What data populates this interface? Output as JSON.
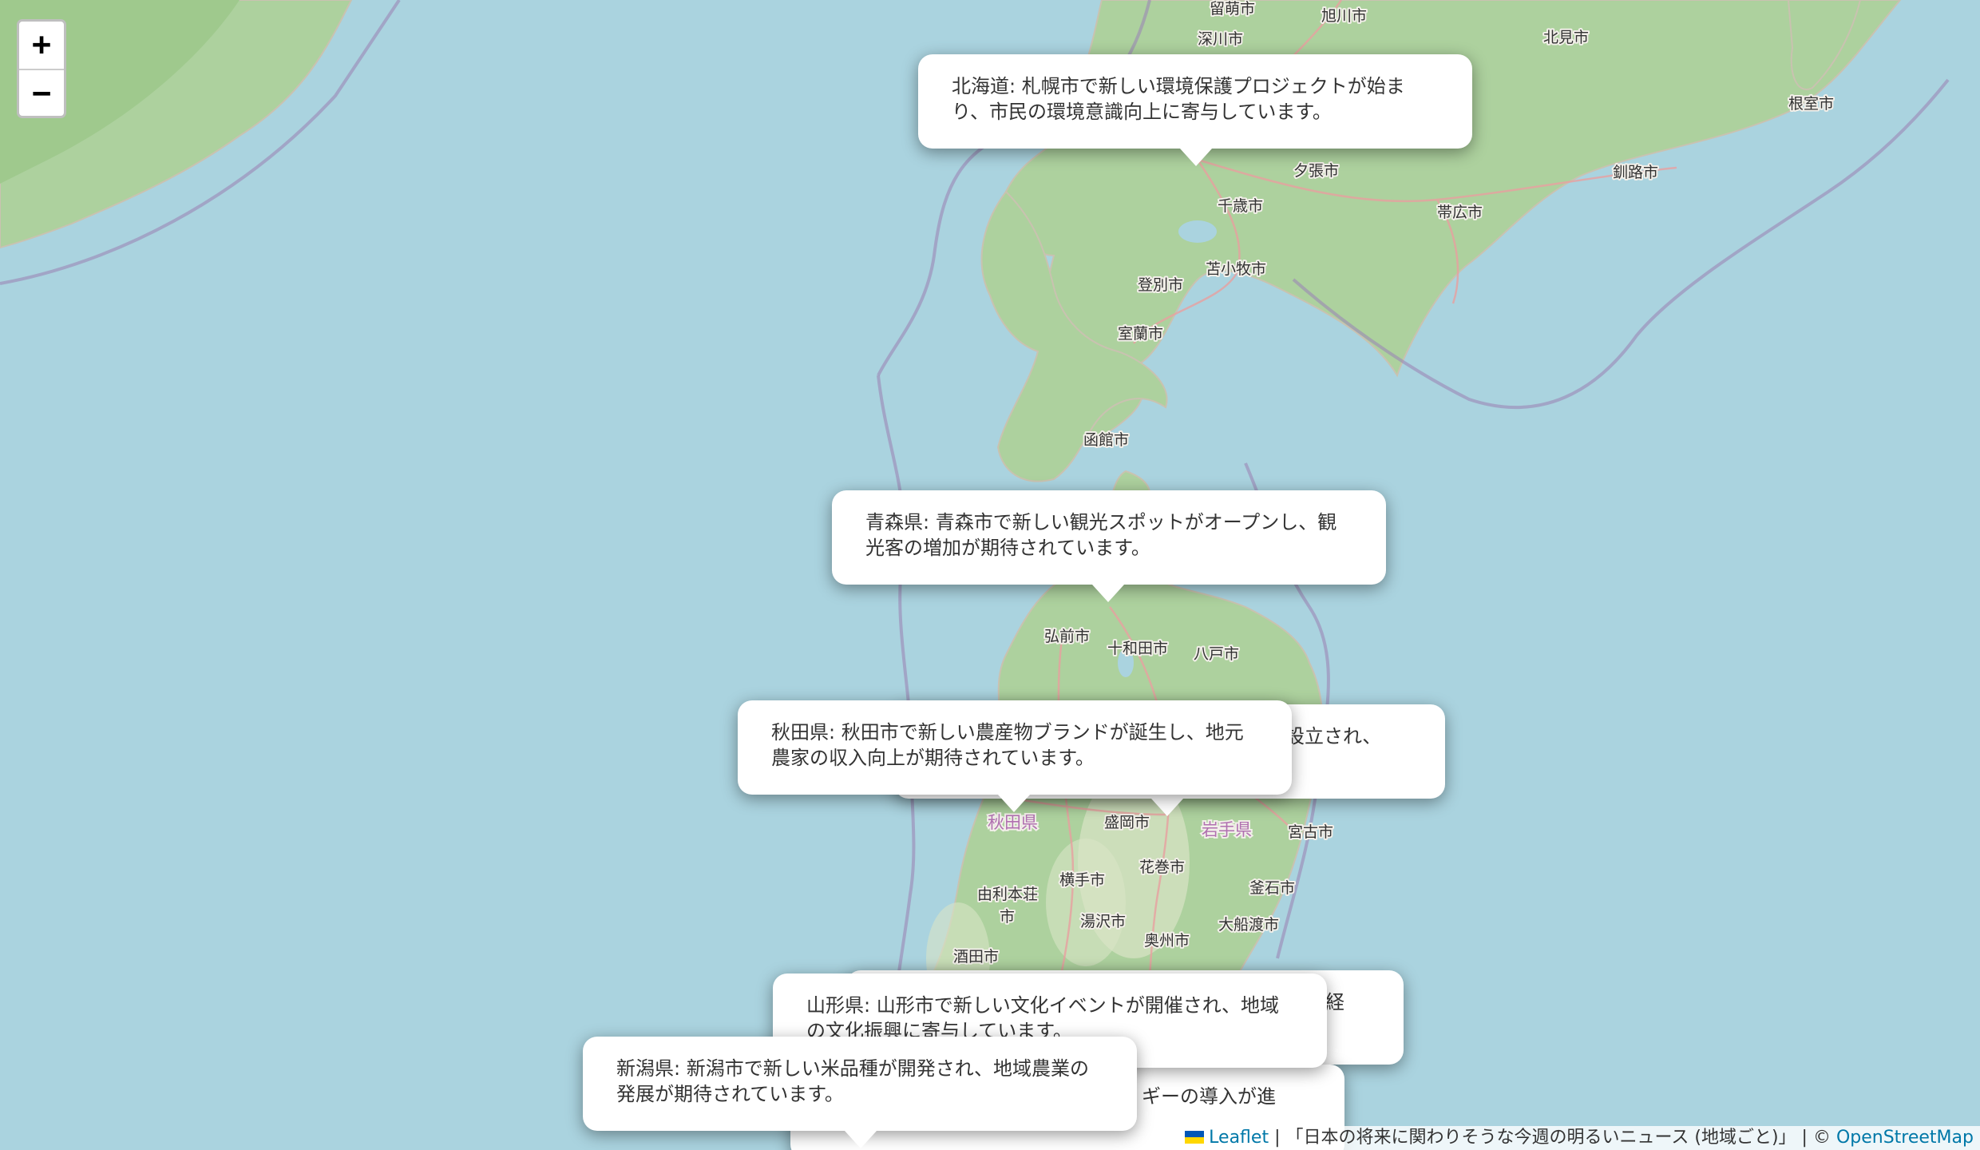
{
  "map": {
    "colors": {
      "water": "#aad3df",
      "land": "#f2efe9",
      "forest": "#add19e",
      "maritime_border": "#9b87b6",
      "road": "#e8a0a0"
    },
    "places": [
      "留萌市",
      "旭川市",
      "深川市",
      "北見市",
      "根室市",
      "夕張市",
      "千歳市",
      "帯広市",
      "釧路市",
      "苫小牧市",
      "登別市",
      "室蘭市",
      "函館市",
      "弘前市",
      "十和田市",
      "八戸市",
      "盛岡市",
      "宮古市",
      "横手市",
      "花巻市",
      "由利本荘",
      "市",
      "湯沢市",
      "釜石市",
      "奥州市",
      "大船渡市",
      "酒田市"
    ],
    "prefectures": [
      "秋田県",
      "岩手県"
    ]
  },
  "zoom": {
    "in_label": "+",
    "out_label": "−"
  },
  "popups": [
    {
      "text": "北海道: 札幌市で新しい環境保護プロジェクトが始まり、市民の環境意識向上に寄与しています。"
    },
    {
      "text": "青森県: 青森市で新しい観光スポットがオープンし、観光客の増加が期待されています。"
    },
    {
      "text": "設立され、"
    },
    {
      "text": "秋田県: 秋田市で新しい農産物ブランドが誕生し、地元農家の収入向上が期待されています。"
    },
    {
      "text": "経"
    },
    {
      "text": "山形県: 山形市で新しい文化イベントが開催され、地域の文化振興に寄与しています。"
    },
    {
      "text": "ギーの導入が進"
    },
    {
      "text": "新潟県: 新潟市で新しい米品種が開発され、地域農業の発展が期待されています。"
    }
  ],
  "attribution": {
    "leaflet": "Leaflet",
    "sep": " | ",
    "title": "「日本の将来に関わりそうな今週の明るいニュース (地域ごと)」",
    "copy": " | © ",
    "osm": "OpenStreetMap"
  }
}
